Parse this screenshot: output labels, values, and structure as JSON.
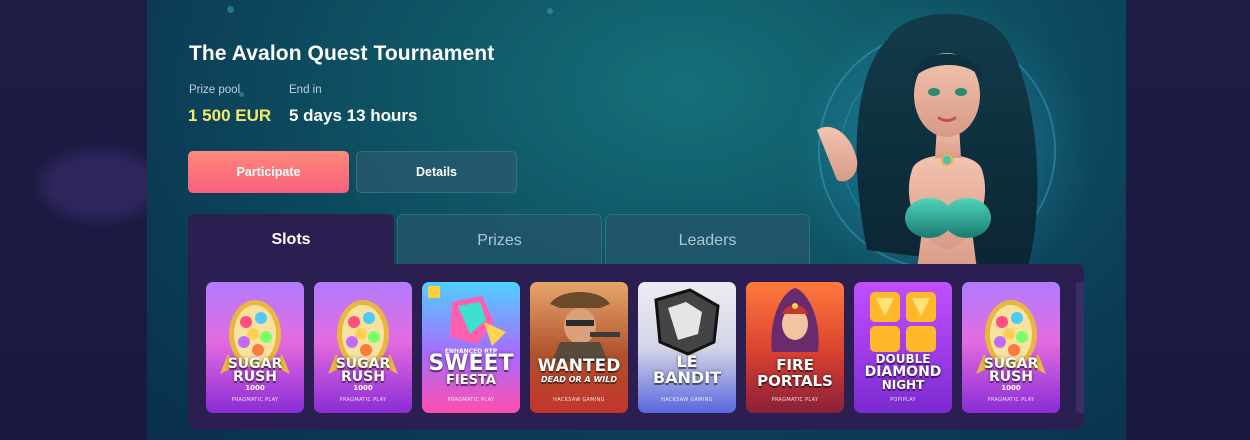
{
  "tournament": {
    "title": "The Avalon Quest Tournament",
    "prize_label": "Prize pool",
    "prize_value": "1 500 EUR",
    "end_label": "End in",
    "end_value": "5 days 13 hours"
  },
  "actions": {
    "participate_label": "Participate",
    "details_label": "Details"
  },
  "tabs": [
    {
      "label": "Slots",
      "active": true
    },
    {
      "label": "Prizes",
      "active": false
    },
    {
      "label": "Leaders",
      "active": false
    }
  ],
  "games": [
    {
      "title_line1": "SUGAR",
      "title_line2": "RUSH",
      "sub": "1000",
      "provider": "PRAGMATIC PLAY"
    },
    {
      "title_line1": "SUGAR",
      "title_line2": "RUSH",
      "sub": "1000",
      "provider": "PRAGMATIC PLAY"
    },
    {
      "title_line1": "SWEET",
      "title_line2": "FIESTA",
      "sub": "ENHANCED RTP",
      "provider": "PRAGMATIC PLAY"
    },
    {
      "title_line1": "WANTED",
      "title_line2": "DEAD OR A WILD",
      "sub": "",
      "provider": "HACKSAW GAMING"
    },
    {
      "title_line1": "LE",
      "title_line2": "BANDIT",
      "sub": "",
      "provider": "HACKSAW GAMING"
    },
    {
      "title_line1": "FIRE",
      "title_line2": "PORTALS",
      "sub": "",
      "provider": "PRAGMATIC PLAY"
    },
    {
      "title_line1": "DOUBLE",
      "title_line2": "DIAMOND",
      "title_line3": "NIGHT",
      "provider": "POPIPLAY"
    },
    {
      "title_line1": "SUGAR",
      "title_line2": "RUSH",
      "sub": "1000",
      "provider": "PRAGMATIC PLAY"
    }
  ],
  "colors": {
    "accent_prize": "#f5e86a",
    "participate_start": "#ff8a7a",
    "participate_end": "#f85f7d",
    "panel": "#2a1f50"
  }
}
